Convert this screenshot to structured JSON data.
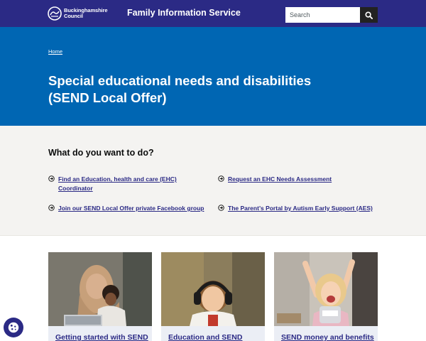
{
  "header": {
    "logo_line1": "Buckinghamshire",
    "logo_line2": "Council",
    "service_name": "Family Information Service",
    "search_placeholder": "Search"
  },
  "hero": {
    "breadcrumb_home": "Home",
    "title": "Special educational needs and disabilities (SEND Local Offer)"
  },
  "tasks": {
    "heading": "What do you want to do?",
    "links": [
      "Find an Education, health and care (EHC) Coordinator",
      "Request an EHC Needs Assessment",
      "Join our SEND Local Offer private Facebook group",
      "The Parent’s Portal by Autism Early Support (AES)"
    ]
  },
  "cards": [
    {
      "title": "Getting started with SEND"
    },
    {
      "title": "Education and SEND"
    },
    {
      "title": "SEND money and benefits"
    }
  ],
  "colors": {
    "header_bg": "#2b2a85",
    "hero_bg": "#0066b3",
    "tasks_bg": "#f4f3f1",
    "link": "#2b2a85"
  },
  "icons": [
    "council-logo-icon",
    "search-icon",
    "arrow-circle-icon",
    "cookie-icon"
  ]
}
